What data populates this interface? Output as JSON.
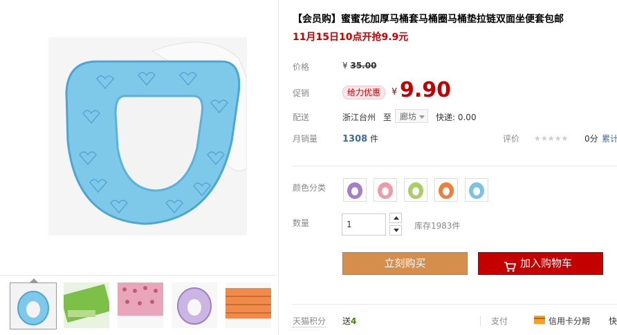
{
  "product": {
    "title": "【会员购】蜜蜜花加厚马桶套马桶圈马桶垫拉链双面坐便套包邮",
    "promo_line": "11月15日10点开抢9.9元"
  },
  "price": {
    "label": "价格",
    "currency": "¥",
    "original": "35.00"
  },
  "promotion": {
    "label": "促销",
    "badge": "给力优惠",
    "currency": "¥",
    "price": "9.90"
  },
  "shipping": {
    "label": "配送",
    "from": "浙江台州",
    "to_word": "至",
    "destination": "廊坊",
    "express": "快递: 0.00"
  },
  "sales": {
    "label": "月销量",
    "count": "1308",
    "unit": "件",
    "rating_label": "评价",
    "stars": "★★★★★",
    "score": "0分",
    "cumulative": "累计"
  },
  "colors": {
    "label": "颜色分类",
    "swatches": [
      {
        "name": "purple",
        "color": "#a57ec8"
      },
      {
        "name": "pink",
        "color": "#f09aa8"
      },
      {
        "name": "green",
        "color": "#a7cf63"
      },
      {
        "name": "orange",
        "color": "#ee7f3a"
      },
      {
        "name": "blue",
        "color": "#79c3e8"
      }
    ]
  },
  "quantity": {
    "label": "数量",
    "value": "1",
    "stock": "库存1983件"
  },
  "actions": {
    "buy_now": "立刻购买",
    "add_to_cart": "加入购物车"
  },
  "footer": {
    "points_label": "天猫积分",
    "points_prefix": "送",
    "points_value": "4",
    "pay_label": "支付",
    "card_label": "信用卡分期",
    "more": "快"
  },
  "theme": {
    "accent_red": "#c40000",
    "buy_orange": "#d58e4b",
    "product_blue": "#7ec8ea"
  }
}
